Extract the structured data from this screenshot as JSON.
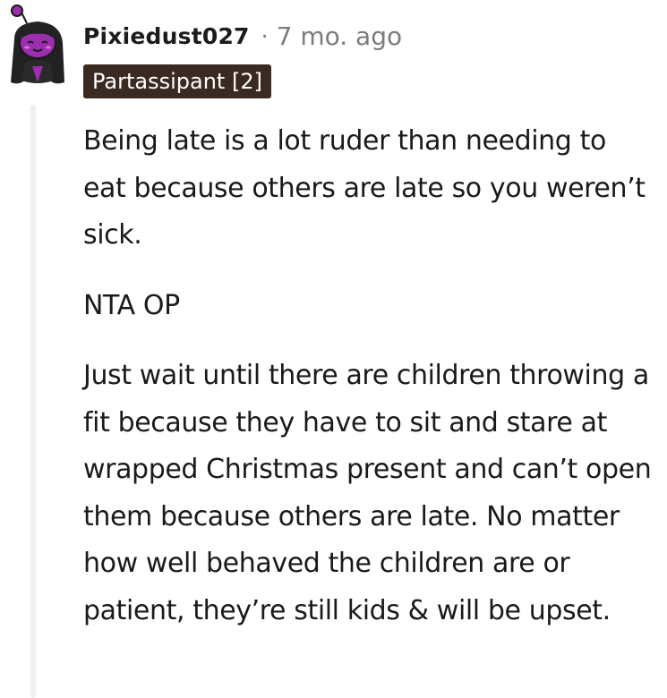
{
  "comment": {
    "username": "Pixiedust027",
    "separator": "·",
    "timestamp": "7 mo. ago",
    "flair": "Partassipant [2]",
    "paragraphs": [
      "Being late is a lot ruder than needing to eat because others are late so you weren’t sick.",
      "NTA OP",
      "Just wait until there are children throwing a fit because they have to sit and stare at wrapped Christmas present and can’t open them because others are late. No matter how well behaved the children are or patient, they’re still kids & will be upset."
    ]
  },
  "colors": {
    "flair_bg": "#3b2a22",
    "avatar_accent": "#9b2fae",
    "thread_line": "#edeff1",
    "meta_text": "#7c7c7c"
  },
  "icons": {
    "avatar": "snoo-avatar-icon"
  }
}
